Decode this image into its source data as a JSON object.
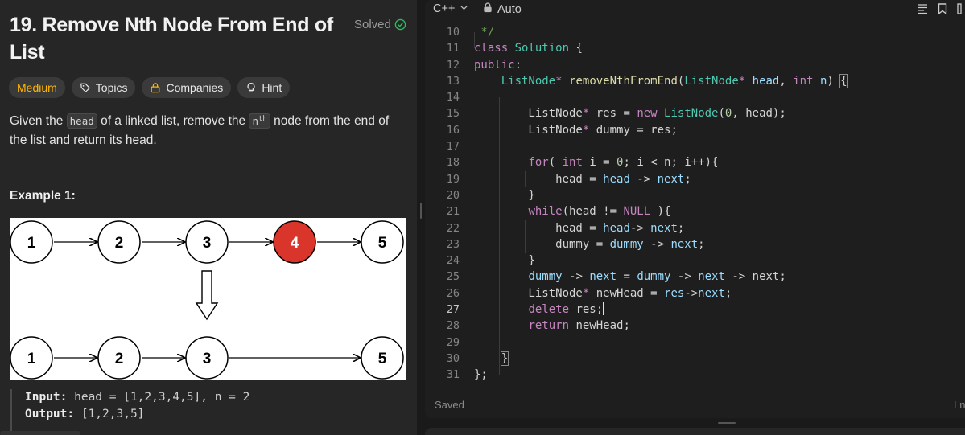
{
  "problem": {
    "title": "19. Remove Nth Node From End of List",
    "status": "Solved",
    "tags": {
      "difficulty": "Medium",
      "topics": "Topics",
      "companies": "Companies",
      "hint": "Hint"
    },
    "description": {
      "p1": "Given the ",
      "code1": "head",
      "p2": " of a linked list, remove the ",
      "code2": "n",
      "code2_sup": "th",
      "p3": " node from the end of the list and return its head."
    },
    "example_title": "Example 1:",
    "diagram": {
      "top_row": [
        "1",
        "2",
        "3",
        "4",
        "5"
      ],
      "bottom_row": [
        "1",
        "2",
        "3",
        "5"
      ],
      "highlight_color": "#d9352a"
    },
    "example": {
      "input_label": "Input:",
      "input_value": " head = [1,2,3,4,5], n = 2",
      "output_label": "Output:",
      "output_value": " [1,2,3,5]"
    }
  },
  "editor": {
    "language": "C++",
    "mode": "Auto",
    "status": "Saved",
    "status_right": "Ln",
    "current_line": "27",
    "line_numbers": [
      "10",
      "11",
      "12",
      "13",
      "14",
      "15",
      "16",
      "17",
      "18",
      "19",
      "20",
      "21",
      "22",
      "23",
      "24",
      "25",
      "26",
      "27",
      "28",
      "29",
      "30",
      "31"
    ]
  },
  "colors": {
    "accent_medium": "#ffb800",
    "solved_green": "#2cbb5d",
    "editor_bg": "#1e1e1e",
    "panel_bg": "#262626"
  }
}
